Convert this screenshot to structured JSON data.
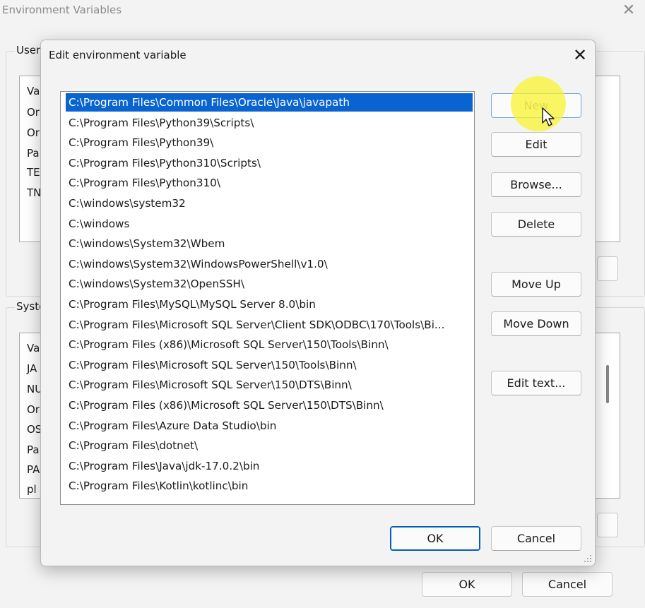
{
  "background_window": {
    "title": "Environment Variables",
    "user_group_label": "User",
    "user_header": "Va",
    "user_rows": [
      "Or",
      "Or",
      "Pa",
      "TE",
      "TN"
    ],
    "system_group_label": "Syste",
    "system_header": "Va",
    "system_rows": [
      "JA",
      "NU",
      "Or",
      "OS",
      "Pa",
      "PA",
      "pl"
    ],
    "ok_label": "OK",
    "cancel_label": "Cancel"
  },
  "dialog": {
    "title": "Edit environment variable",
    "close_glyph": "✕",
    "paths": [
      "C:\\Program Files\\Common Files\\Oracle\\Java\\javapath",
      "C:\\Program Files\\Python39\\Scripts\\",
      "C:\\Program Files\\Python39\\",
      "C:\\Program Files\\Python310\\Scripts\\",
      "C:\\Program Files\\Python310\\",
      "C:\\windows\\system32",
      "C:\\windows",
      "C:\\windows\\System32\\Wbem",
      "C:\\windows\\System32\\WindowsPowerShell\\v1.0\\",
      "C:\\windows\\System32\\OpenSSH\\",
      "C:\\Program Files\\MySQL\\MySQL Server 8.0\\bin",
      "C:\\Program Files\\Microsoft SQL Server\\Client SDK\\ODBC\\170\\Tools\\Bi...",
      "C:\\Program Files (x86)\\Microsoft SQL Server\\150\\Tools\\Binn\\",
      "C:\\Program Files\\Microsoft SQL Server\\150\\Tools\\Binn\\",
      "C:\\Program Files\\Microsoft SQL Server\\150\\DTS\\Binn\\",
      "C:\\Program Files (x86)\\Microsoft SQL Server\\150\\DTS\\Binn\\",
      "C:\\Program Files\\Azure Data Studio\\bin",
      "C:\\Program Files\\dotnet\\",
      "C:\\Program Files\\Java\\jdk-17.0.2\\bin",
      "C:\\Program Files\\Kotlin\\kotlinc\\bin"
    ],
    "selected_index": 0,
    "buttons": {
      "new": "New",
      "edit": "Edit",
      "browse": "Browse...",
      "delete": "Delete",
      "move_up": "Move Up",
      "move_down": "Move Down",
      "edit_text": "Edit text...",
      "ok": "OK",
      "cancel": "Cancel"
    }
  },
  "colors": {
    "selection": "#0a64d0",
    "primary_border": "#005fb8",
    "highlight": "#faf428"
  }
}
